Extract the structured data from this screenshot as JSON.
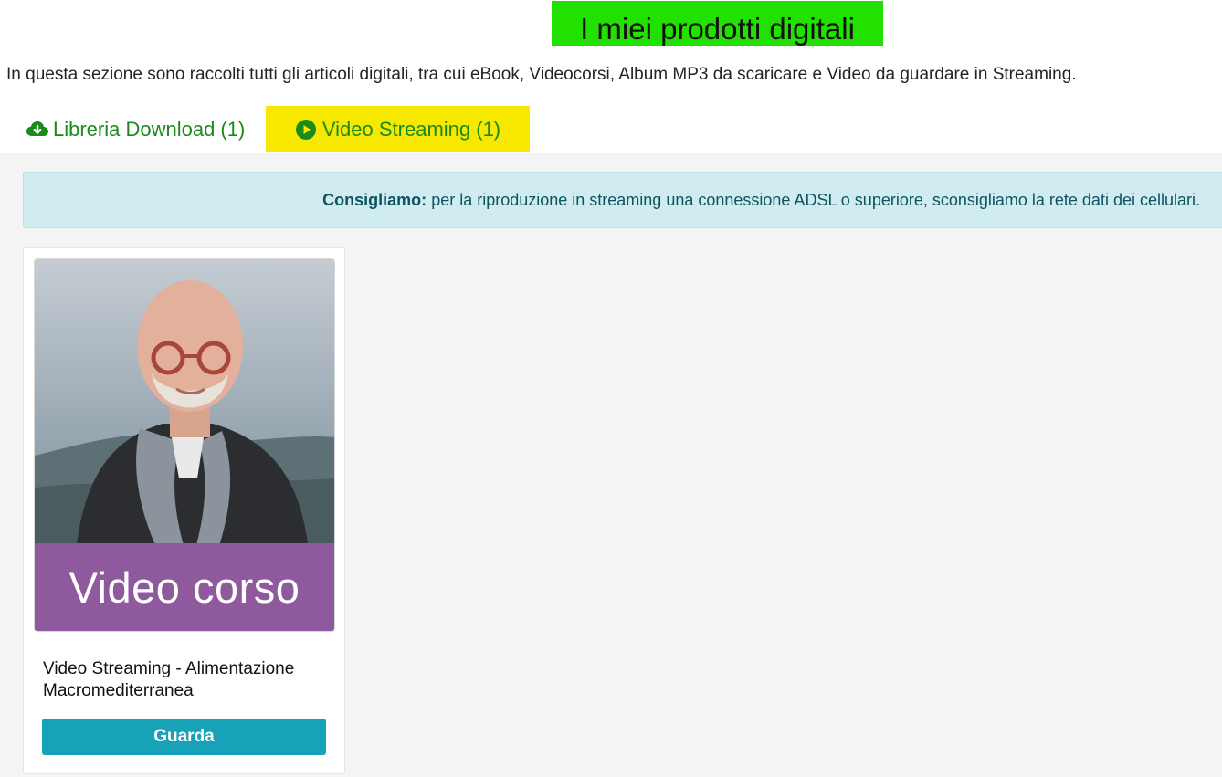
{
  "header": {
    "title": "I miei prodotti digitali",
    "intro": "In questa sezione sono raccolti tutti gli articoli digitali, tra cui eBook, Videocorsi, Album MP3 da scaricare e Video da guardare in Streaming."
  },
  "tabs": [
    {
      "label": "Libreria Download (1)",
      "icon": "cloud-download-icon",
      "active": false
    },
    {
      "label": "Video Streaming (1)",
      "icon": "play-circle-icon",
      "active": true
    }
  ],
  "notice": {
    "strong": "Consigliamo:",
    "text": "per la riproduzione in streaming una connessione ADSL o superiore, sconsigliamo la rete dati dei cellulari."
  },
  "products": [
    {
      "thumb_label": "Video corso",
      "title": "Video Streaming - Alimentazione Macromediterranea",
      "button_label": "Guarda"
    }
  ],
  "colors": {
    "title_highlight": "#22e000",
    "active_tab_highlight": "#f6e800",
    "tab_text": "#1a8a1a",
    "notice_bg": "#d1ecf1",
    "notice_text": "#0c5460",
    "thumb_band": "#8e5a9d",
    "button": "#17a2b8"
  }
}
